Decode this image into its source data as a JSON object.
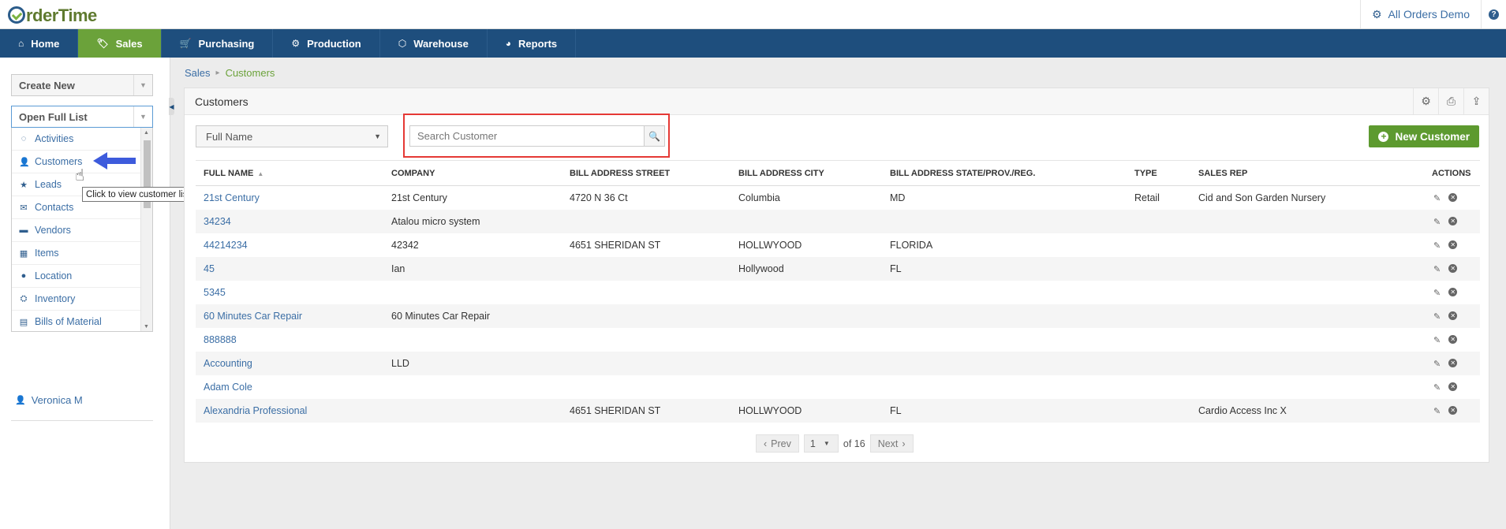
{
  "app": {
    "logo": "rderTime",
    "company": "All Orders Demo",
    "help": "?"
  },
  "nav": [
    {
      "label": "Home",
      "icon": "home-icon",
      "glyph": "⌂"
    },
    {
      "label": "Sales",
      "icon": "tag-icon",
      "glyph": "🏷"
    },
    {
      "label": "Purchasing",
      "icon": "cart-icon",
      "glyph": "🛒"
    },
    {
      "label": "Production",
      "icon": "cogs-icon",
      "glyph": "⚙"
    },
    {
      "label": "Warehouse",
      "icon": "box-icon",
      "glyph": "⬡"
    },
    {
      "label": "Reports",
      "icon": "pie-chart-icon",
      "glyph": "◕"
    }
  ],
  "sidebar": {
    "create_new": "Create New",
    "open_full_list": "Open Full List",
    "items": [
      {
        "label": "Activities",
        "icon": "activities-icon",
        "glyph": "◌"
      },
      {
        "label": "Customers",
        "icon": "user-icon",
        "glyph": "👤"
      },
      {
        "label": "Leads",
        "icon": "star-icon",
        "glyph": "★"
      },
      {
        "label": "Contacts",
        "icon": "envelope-icon",
        "glyph": "✉"
      },
      {
        "label": "Vendors",
        "icon": "vendor-icon",
        "glyph": "▬"
      },
      {
        "label": "Items",
        "icon": "grid-icon",
        "glyph": "▦"
      },
      {
        "label": "Location",
        "icon": "map-pin-icon",
        "glyph": "●"
      },
      {
        "label": "Inventory",
        "icon": "inventory-icon",
        "glyph": "⛭"
      },
      {
        "label": "Bills of Material",
        "icon": "bom-icon",
        "glyph": "▤"
      }
    ],
    "user": "Veronica M",
    "tooltip": "Click to view customer list"
  },
  "breadcrumb": {
    "parent": "Sales",
    "current": "Customers"
  },
  "panel": {
    "title": "Customers",
    "filter_field": "Full Name",
    "search_placeholder": "Search Customer",
    "new_button": "New Customer"
  },
  "table": {
    "columns": [
      "FULL NAME",
      "COMPANY",
      "BILL ADDRESS STREET",
      "BILL ADDRESS CITY",
      "BILL ADDRESS STATE/PROV./REG.",
      "TYPE",
      "SALES REP",
      "ACTIONS"
    ],
    "rows": [
      [
        "21st Century",
        "21st Century",
        "4720 N 36 Ct",
        "Columbia",
        "MD",
        "Retail",
        "Cid and Son Garden Nursery"
      ],
      [
        "34234",
        "Atalou micro system",
        "",
        "",
        "",
        "",
        ""
      ],
      [
        "44214234",
        "42342",
        "4651 SHERIDAN ST",
        "HOLLWYOOD",
        "FLORIDA",
        "",
        ""
      ],
      [
        "45",
        "Ian",
        "",
        "Hollywood",
        "FL",
        "",
        ""
      ],
      [
        "5345",
        "",
        "",
        "",
        "",
        "",
        ""
      ],
      [
        "60 Minutes Car Repair",
        "60 Minutes Car Repair",
        "",
        "",
        "",
        "",
        ""
      ],
      [
        "888888",
        "",
        "",
        "",
        "",
        "",
        ""
      ],
      [
        "Accounting",
        "LLD",
        "",
        "",
        "",
        "",
        ""
      ],
      [
        "Adam Cole",
        "",
        "",
        "",
        "",
        "",
        ""
      ],
      [
        "Alexandria Professional",
        "",
        "4651 SHERIDAN ST",
        "HOLLWYOOD",
        "FL",
        "",
        "Cardio Access Inc X"
      ]
    ]
  },
  "pager": {
    "prev": "Prev",
    "page": "1",
    "of": "of 16",
    "next": "Next"
  },
  "colors": {
    "nav": "#1e4e7d",
    "active": "#6ba23a",
    "link": "#3b6ea5",
    "highlight": "#e53935"
  }
}
